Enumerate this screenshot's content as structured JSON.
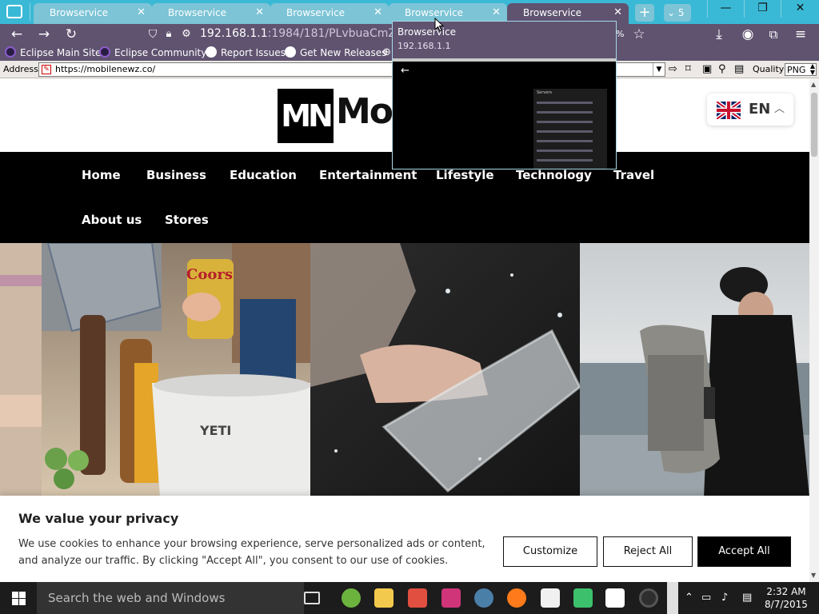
{
  "tabs": [
    {
      "label": "Browservice"
    },
    {
      "label": "Browservice"
    },
    {
      "label": "Browservice"
    },
    {
      "label": "Browservice"
    },
    {
      "label": "Browservice"
    }
  ],
  "tab_overflow_count": "5",
  "toolbar": {
    "url_host": "192.168.1.1",
    "url_rest": ":1984/181/PLvbuaCmZi0hjv",
    "zoom_fragment": "%"
  },
  "bookmarks": [
    {
      "label": "Eclipse Main Site"
    },
    {
      "label": "Eclipse Community"
    },
    {
      "label": "Report Issues"
    },
    {
      "label": "Get New Releases"
    }
  ],
  "address_bar": {
    "label": "Address",
    "value": "https://mobilenewz.co/",
    "quality_label": "Quality",
    "quality_value": "PNG"
  },
  "popup": {
    "title": "Browservice",
    "url": "192.168.1.1",
    "panel_title": "Servers"
  },
  "site": {
    "logo_mark": "MN",
    "logo_text": "Mob",
    "language": "EN",
    "nav": [
      "Home",
      "Business",
      "Education",
      "Entertainment",
      "Lifestyle",
      "Technology",
      "Travel",
      "About us",
      "Stores"
    ],
    "cookie": {
      "title": "We value your privacy",
      "text": "We use cookies to enhance your browsing experience, serve personalized ads or content, and analyze our traffic. By clicking \"Accept All\", you consent to our use of cookies.",
      "customize": "Customize",
      "reject": "Reject All",
      "accept": "Accept All"
    },
    "hero_brand_1": "Coors",
    "hero_brand_2": "YETI"
  },
  "taskbar": {
    "search_placeholder": "Search the web and Windows",
    "time": "2:32 AM",
    "date": "8/7/2015"
  },
  "colors": {
    "tab_strip": "#3ab9d6",
    "toolbar": "#5f5370",
    "nav": "#000000"
  }
}
